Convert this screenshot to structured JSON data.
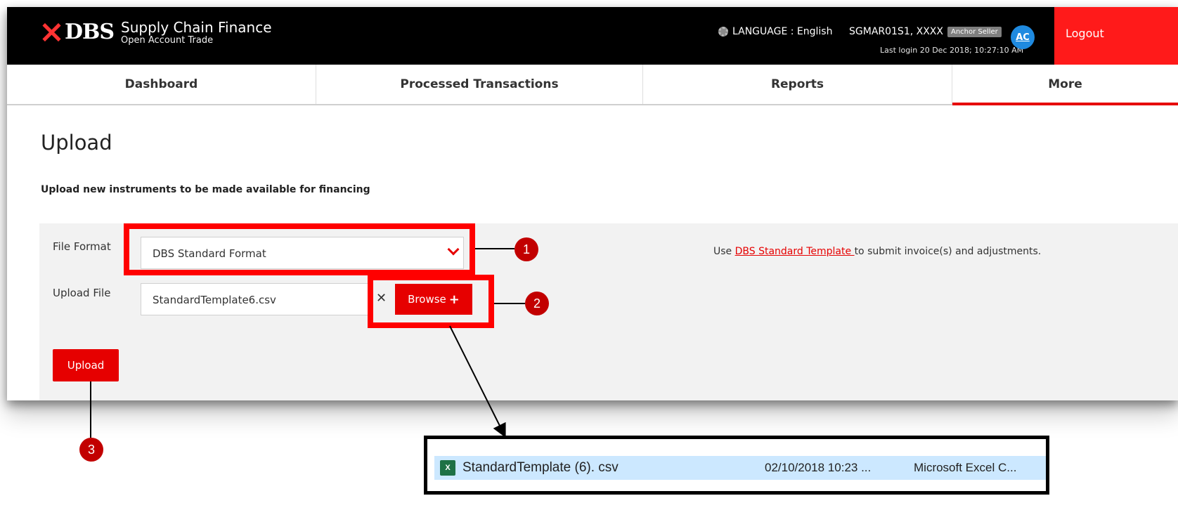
{
  "header": {
    "logo_text": "DBS",
    "app_title": "Supply Chain Finance",
    "app_subtitle": "Open Account Trade",
    "language": "LANGUAGE : English",
    "user": "SGMAR01S1, XXXX",
    "role": "Anchor Seller",
    "last_login": "Last login 20 Dec 2018; 10:27:10 AM",
    "avatar": "AC",
    "logout": "Logout"
  },
  "nav": {
    "items": [
      {
        "label": "Dashboard"
      },
      {
        "label": "Processed Transactions"
      },
      {
        "label": "Reports"
      },
      {
        "label": "More"
      }
    ]
  },
  "page": {
    "title": "Upload",
    "subtitle": "Upload new instruments to be made available for financing"
  },
  "form": {
    "file_format_label": "File Format",
    "file_format_value": "DBS Standard Format",
    "upload_file_label": "Upload File",
    "upload_file_value": "StandardTemplate6.csv",
    "clear_glyph": "✕",
    "browse_label": "Browse",
    "browse_plus": "+",
    "template_note_prefix": "Use ",
    "template_link": "DBS Standard Template ",
    "template_note_suffix": "to submit invoice(s) and adjustments.",
    "upload_button": "Upload"
  },
  "annotations": {
    "markers": [
      "1",
      "2",
      "3"
    ],
    "highlight_color": "#ff0000"
  },
  "file_popup": {
    "icon": "excel-icon",
    "file_name": "StandardTemplate (6). csv",
    "modified": "02/10/2018 10:23 ...",
    "file_type": "Microsoft Excel C..."
  },
  "colors": {
    "brand_red": "#e60000",
    "header_bg": "#000000",
    "panel_bg": "#f2f2f2",
    "avatar_blue": "#1f8ae0"
  }
}
